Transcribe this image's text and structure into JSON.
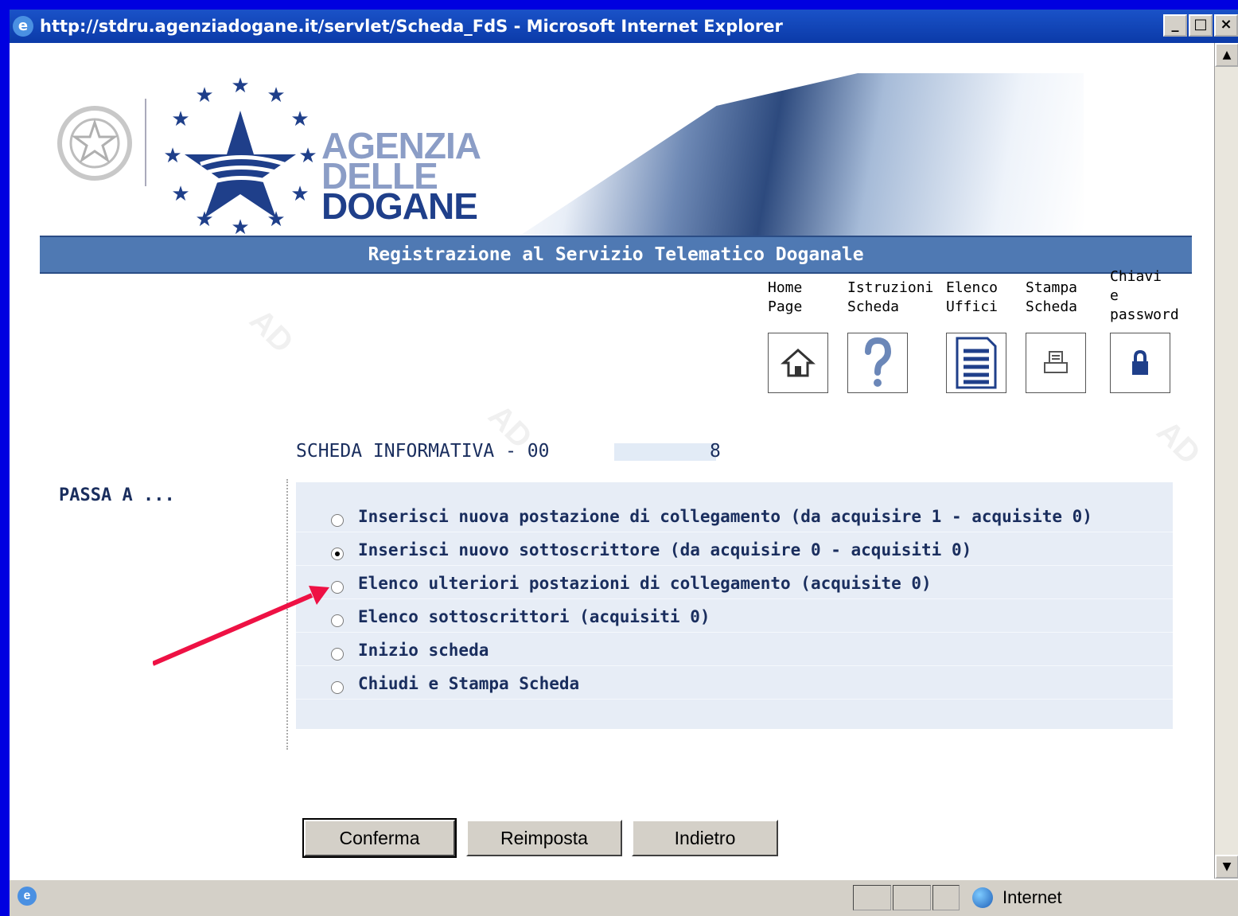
{
  "window": {
    "title": "http://stdru.agenziadogane.it/servlet/Scheda_FdS - Microsoft Internet Explorer",
    "minimize": "_",
    "maximize": "□",
    "close": "×"
  },
  "logo": {
    "line1": "AGENZIA",
    "line2": "DELLE",
    "line3": "DOGANE"
  },
  "banner": {
    "title": "Registrazione al Servizio Telematico Doganale"
  },
  "toolbar": [
    {
      "label": "Home\nPage",
      "icon": "home-icon"
    },
    {
      "label": "Istruzioni\nScheda",
      "icon": "help-icon"
    },
    {
      "label": "Elenco\nUffici",
      "icon": "document-list-icon"
    },
    {
      "label": "Stampa\nScheda",
      "icon": "printer-icon"
    },
    {
      "label": "Chiavi\ne\npassword",
      "icon": "lock-icon"
    }
  ],
  "scheda": {
    "prefix": "SCHEDA INFORMATIVA - 00",
    "suffix": "8"
  },
  "passa_label": "PASSA A ...",
  "options": [
    {
      "label": "Inserisci nuova postazione di collegamento (da acquisire 1 - acquisite 0)",
      "selected": false
    },
    {
      "label": "Inserisci nuovo sottoscrittore (da acquisire 0 - acquisiti 0)",
      "selected": true
    },
    {
      "label": "Elenco ulteriori postazioni di collegamento  (acquisite 0)",
      "selected": false
    },
    {
      "label": "Elenco sottoscrittori (acquisiti 0)",
      "selected": false
    },
    {
      "label": "Inizio scheda",
      "selected": false
    },
    {
      "label": "Chiudi e Stampa Scheda",
      "selected": false
    }
  ],
  "buttons": {
    "confirm": "Conferma",
    "reset": "Reimposta",
    "back": "Indietro"
  },
  "status": {
    "zone": "Internet"
  },
  "colors": {
    "banner": "#4f79b3",
    "text": "#1a2e5e",
    "annotation_arrow": "#ee1144"
  }
}
